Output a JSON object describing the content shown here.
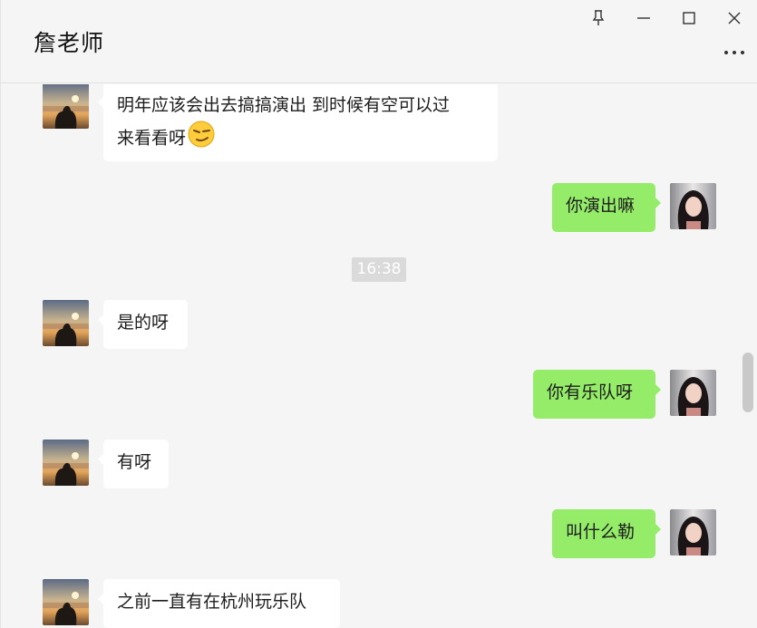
{
  "window": {
    "title": "詹老师",
    "controls": [
      "pin-icon",
      "minimize-icon",
      "maximize-icon",
      "close-icon"
    ],
    "more_icon": "more-dots-icon"
  },
  "messages": [
    {
      "from": "contact",
      "text": "明年应该会出去搞搞演出 到时候有空可以过",
      "text2": "来看看呀",
      "emoji": "smirk-emoji"
    },
    {
      "from": "me",
      "text": "你演出嘛"
    },
    {
      "type": "time",
      "text": "16:38"
    },
    {
      "from": "contact",
      "text": "是的呀"
    },
    {
      "from": "me",
      "text": "你有乐队呀"
    },
    {
      "from": "contact",
      "text": "有呀"
    },
    {
      "from": "me",
      "text": "叫什么勒"
    },
    {
      "from": "contact",
      "text": "之前一直有在杭州玩乐队"
    }
  ],
  "colors": {
    "outgoing_bubble": "#95ec69",
    "incoming_bubble": "#ffffff",
    "background": "#f5f5f5"
  }
}
